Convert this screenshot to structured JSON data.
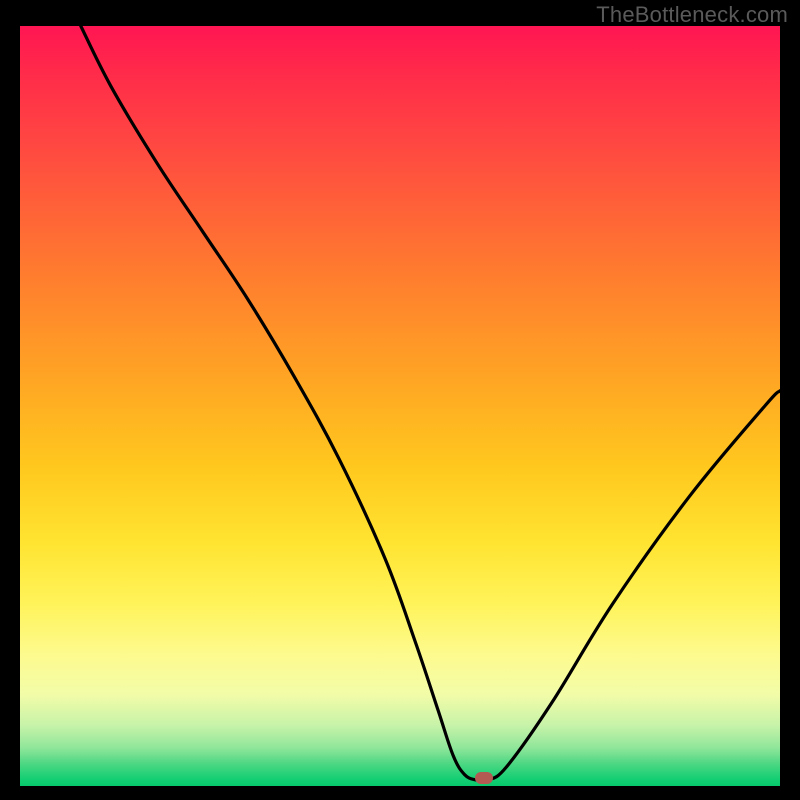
{
  "watermark": "TheBottleneck.com",
  "colors": {
    "frame": "#000000",
    "curve": "#000000",
    "marker": "#b35a53",
    "gradient_stops": [
      "#ff1552",
      "#ff2a4a",
      "#ff4f3f",
      "#ff7a2f",
      "#ffa424",
      "#ffc81e",
      "#ffe431",
      "#fff35a",
      "#fdfb90",
      "#f2fca8",
      "#c7f3a9",
      "#8fe69a",
      "#4fd884",
      "#16cf74",
      "#07c96d"
    ]
  },
  "chart_data": {
    "type": "line",
    "title": "",
    "xlabel": "",
    "ylabel": "",
    "xlim": [
      0,
      100
    ],
    "ylim": [
      0,
      100
    ],
    "grid": false,
    "legend": false,
    "series": [
      {
        "name": "bottleneck-curve",
        "x": [
          8,
          12,
          18,
          24,
          30,
          36,
          42,
          48,
          52,
          55,
          57,
          58.5,
          60,
          61.5,
          64,
          70,
          78,
          88,
          98,
          100
        ],
        "values": [
          100,
          92,
          82,
          73,
          64,
          54,
          43,
          30,
          19,
          10,
          4,
          1.5,
          0.8,
          0.8,
          2.5,
          11,
          24,
          38,
          50,
          52
        ]
      }
    ],
    "annotations": [
      {
        "name": "optimal-marker",
        "x": 61,
        "y": 1
      }
    ]
  }
}
